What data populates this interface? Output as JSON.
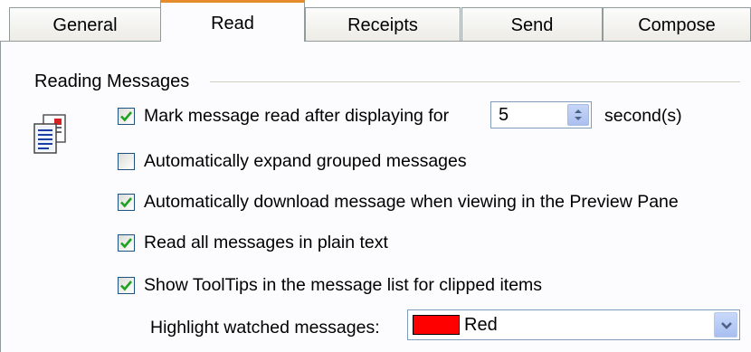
{
  "tabs": [
    {
      "label": "General"
    },
    {
      "label": "Read"
    },
    {
      "label": "Receipts"
    },
    {
      "label": "Send"
    },
    {
      "label": "Compose"
    }
  ],
  "active_tab": "Read",
  "reading": {
    "title": "Reading Messages",
    "mark_read": {
      "label": "Mark message read after displaying for",
      "checked": true,
      "seconds": "5",
      "unit": "second(s)"
    },
    "expand_grouped": {
      "label": "Automatically expand grouped messages",
      "checked": false
    },
    "auto_download": {
      "label": "Automatically download message when viewing in the Preview Pane",
      "checked": true
    },
    "plain_text": {
      "label": "Read all messages in plain text",
      "checked": true
    },
    "tooltips": {
      "label": "Show ToolTips in the message list for clipped items",
      "checked": true
    },
    "highlight": {
      "label": "Highlight watched messages:",
      "value": "Red",
      "color": "#ff0000"
    }
  },
  "icons": {
    "message": "message-document-icon",
    "checkmark": "checkmark-icon",
    "spin": "spin-arrows-icon",
    "dropdown": "chevron-down-icon"
  },
  "colors": {
    "active_tab_accent": "#e68b2c",
    "checkmark": "#21a121",
    "field_border": "#7f9db9"
  }
}
